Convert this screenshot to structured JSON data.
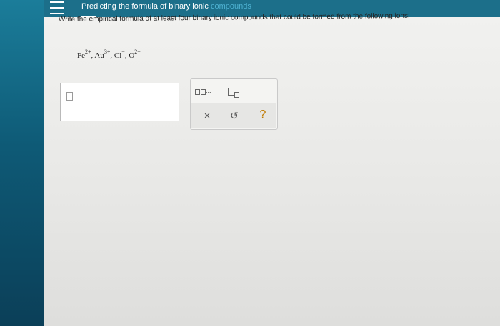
{
  "header": {
    "title": "Predicting the formula of binary ionic",
    "title_tail": "compounds"
  },
  "question": {
    "prompt": "Write the empirical formula of at least four binary ionic compounds that could be formed from the following ions:",
    "ions": [
      {
        "symbol": "Fe",
        "charge": "2+"
      },
      {
        "symbol": "Au",
        "charge": "3+"
      },
      {
        "symbol": "Cl",
        "charge": "−"
      },
      {
        "symbol": "O",
        "charge": "2−"
      }
    ],
    "separator": ", "
  },
  "answer": {
    "value": ""
  },
  "palette": {
    "ellipsis": "...",
    "clear_symbol": "×",
    "undo_symbol": "↺",
    "help_symbol": "?"
  },
  "colors": {
    "accent": "#1c6f8a",
    "help": "#c07a00"
  }
}
